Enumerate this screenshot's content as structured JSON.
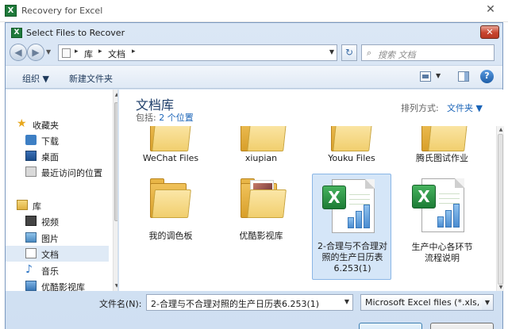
{
  "app": {
    "title": "Recovery for Excel",
    "logo_glyph": "X",
    "close_glyph": "✕"
  },
  "dialog": {
    "title": "Select Files to Recover",
    "icon_glyph": "X",
    "close_glyph": "✕"
  },
  "address": {
    "back_glyph": "◀",
    "forward_glyph": "▶",
    "separator_glyph": "▸",
    "crumbs": [
      "库",
      "文档"
    ],
    "dropdown_glyph": "▼",
    "refresh_glyph": "↻"
  },
  "search": {
    "placeholder": "搜索 文档",
    "icon_glyph": "⌕"
  },
  "toolbar": {
    "organize_label": "组织 ▼",
    "new_folder_label": "新建文件夹",
    "help_glyph": "?"
  },
  "sidebar": {
    "items": [
      {
        "label": "收藏夹",
        "icon": "star-icon"
      },
      {
        "label": "下载",
        "icon": "download-icon"
      },
      {
        "label": "桌面",
        "icon": "desktop-icon"
      },
      {
        "label": "最近访问的位置",
        "icon": "recent-places-icon"
      },
      {
        "label": "库",
        "icon": "library-icon"
      },
      {
        "label": "视频",
        "icon": "video-icon"
      },
      {
        "label": "图片",
        "icon": "pictures-icon"
      },
      {
        "label": "文档",
        "icon": "documents-icon",
        "selected": true
      },
      {
        "label": "音乐",
        "icon": "music-icon"
      },
      {
        "label": "优酷影视库",
        "icon": "youku-icon"
      }
    ]
  },
  "library": {
    "title": "文档库",
    "includes_prefix": "包括:",
    "includes_link": "2 个位置",
    "arrange_label": "排列方式:",
    "arrange_value": "文件夹 ▼"
  },
  "files": [
    {
      "name": "WeChat Files",
      "type": "folder"
    },
    {
      "name": "xiupian",
      "type": "folder"
    },
    {
      "name": "Youku Files",
      "type": "folder"
    },
    {
      "name": "腾氏图试作业",
      "type": "folder"
    },
    {
      "name": "我的调色板",
      "type": "folder"
    },
    {
      "name": "优酷影视库",
      "type": "folder"
    },
    {
      "name": "2-合理与不合理对照的生产日历表6.253(1)",
      "type": "excel",
      "selected": true
    },
    {
      "name": "生产中心各环节流程说明",
      "type": "excel"
    }
  ],
  "file_name": {
    "label": "文件名(N):",
    "value": "2-合理与不合理对照的生产日历表6.253(1)"
  },
  "file_type": {
    "value": "Microsoft Excel files (*.xls, *.x"
  }
}
